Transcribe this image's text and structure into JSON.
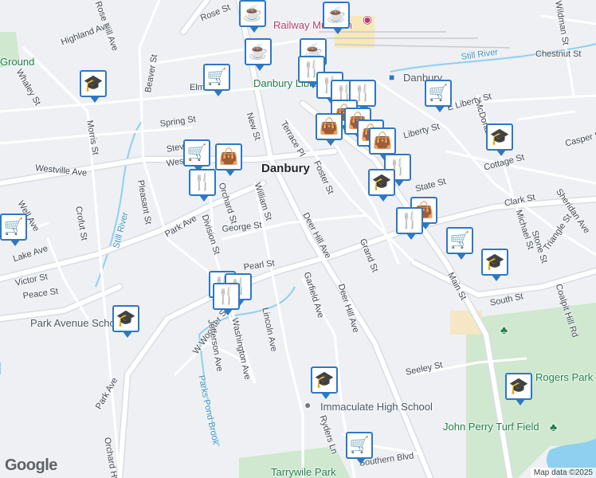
{
  "city_label": "Danbury",
  "streets": {
    "rose_st": "Rose St",
    "rose_hill_ave": "Rose Hill Ave",
    "highland_ave": "Highland Ave",
    "whaley_st": "Whaley St",
    "beaver_st": "Beaver St",
    "morris_st": "Morris St",
    "spring_st": "Spring St",
    "elm_st": "Elm St",
    "new_st": "New St",
    "terrace_pl": "Terrace Pl",
    "stevens_st": "Stevens St",
    "westville_ave": "Westville Ave",
    "west_st": "West St",
    "pleasant_st": "Pleasant St",
    "crofut_st": "Crofut St",
    "well_ave": "Well Ave",
    "still_river_1": "Still River",
    "still_river_2": "Still River",
    "orchard_st": "Orchard St",
    "william_st": "William St",
    "george_st": "George St",
    "park_ave_1": "Park Ave",
    "park_ave_2": "Park Ave",
    "division_st": "Division St",
    "lake_ave": "Lake Ave",
    "victor_st": "Victor St",
    "peace_st": "Peace St",
    "pearl_st": "Pearl St",
    "foster_st": "Foster St",
    "deer_hill_ave_1": "Deer Hill Ave",
    "deer_hill_ave_2": "Deer Hill Ave",
    "garfield_ave": "Garfield Ave",
    "grand_st": "Grand St",
    "w_wooster_st": "W Wooster St",
    "jefferson_ave": "Jefferson Ave",
    "washington_ave": "Washington Ave",
    "lincoln_ave": "Lincoln Ave",
    "parks_pond_brook": "Parks Pond Brook",
    "ryders_ln": "Ryders Ln",
    "southern_blvd": "Southern Blvd",
    "seeley_st": "Seeley St",
    "main_st": "Main St",
    "south_st": "South St",
    "coalpit_hill_rd": "Coalpit Hill Rd",
    "triangle_st": "Triangle St",
    "stone_st": "Stone St",
    "michael_st": "Michael St",
    "clark_st": "Clark St",
    "sheridan_ave": "Sheridan Ave",
    "cottage_st": "Cottage St",
    "casper_st": "Casper St",
    "mcdonald_st": "McDonald St",
    "e_liberty_st": "E Liberty St",
    "liberty_st": "Liberty St",
    "chestnut_st": "Chestnut St",
    "wildman_st": "Wildman St",
    "hts_rd": "Hts Rd",
    "orchard_hts_rd": "Orchard Hts Rd",
    "state_st": "State St",
    "main_st_2": "Main St"
  },
  "pois": {
    "railway_museum": "Railway Museum",
    "danbury_station": "Danbury",
    "danbury_library": "Danbury Library",
    "park_avenue_school": "Park Avenue School",
    "immaculate_high_school": "Immaculate High School",
    "john_perry_turf_field": "John Perry Turf Field",
    "rogers_park": "Rogers Park",
    "tarrywile_park": "Tarrywile Park",
    "ground": "Ground"
  },
  "markers": [
    {
      "type": "school",
      "icon": "🎓"
    },
    {
      "type": "shopping",
      "icon": "🛒"
    },
    {
      "type": "cafe",
      "icon": "☕"
    },
    {
      "type": "restaurant",
      "icon": "🍴"
    },
    {
      "type": "bag",
      "icon": "👜"
    }
  ],
  "colors": {
    "road": "#ffffff",
    "road_edge": "#d7dbe0",
    "water": "#8fd0f0",
    "park": "#c8e6c9",
    "marker_border": "#2f77c4"
  },
  "attribution": "Map data ©2025",
  "logo": "Google"
}
